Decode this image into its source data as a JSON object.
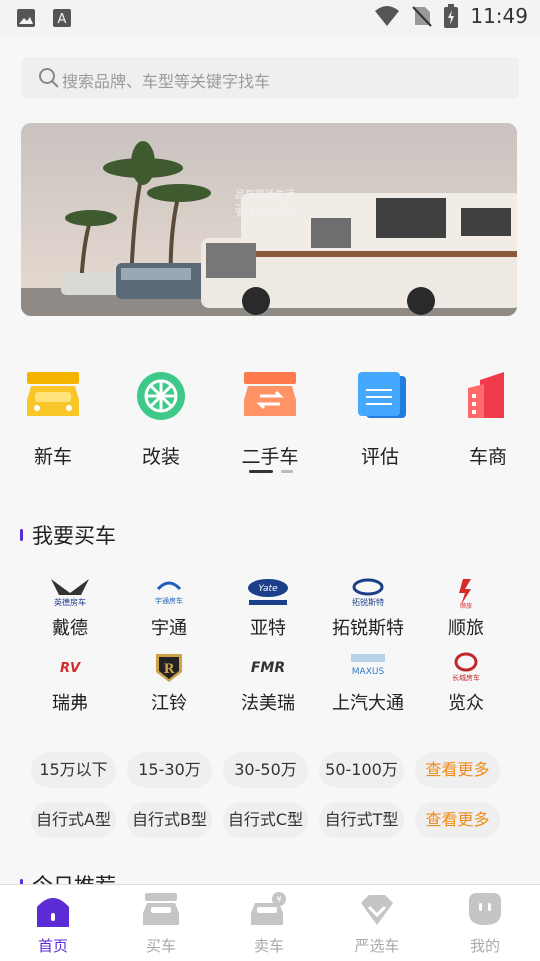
{
  "status_bar": {
    "time": "11:49"
  },
  "search": {
    "placeholder": "搜索品牌、车型等关键字找车"
  },
  "banner": {
    "caption_line1": "品享舒适生活",
    "caption_line2": "安逸出行体验"
  },
  "categories": [
    {
      "label": "新车",
      "icon": "new-car-icon",
      "color": "#f6b400"
    },
    {
      "label": "改装",
      "icon": "wheel-icon",
      "color": "#3cc98a"
    },
    {
      "label": "二手车",
      "icon": "used-car-icon",
      "color": "#ff7a4a"
    },
    {
      "label": "评估",
      "icon": "document-icon",
      "color": "#2a8ff0"
    },
    {
      "label": "车商",
      "icon": "building-icon",
      "color": "#ef3b4a"
    }
  ],
  "section_buy": {
    "title": "我要买车"
  },
  "brands": [
    {
      "name": "戴德",
      "logo_text": "英德房车"
    },
    {
      "name": "宇通",
      "logo_text": "宇通房车"
    },
    {
      "name": "亚特",
      "logo_text": "Yate"
    },
    {
      "name": "拓锐斯特",
      "logo_text": "拓锐斯特"
    },
    {
      "name": "顺旅",
      "logo_text": "顺旅"
    },
    {
      "name": "瑞弗",
      "logo_text": "RV"
    },
    {
      "name": "江铃",
      "logo_text": "R"
    },
    {
      "name": "法美瑞",
      "logo_text": "FMR"
    },
    {
      "name": "上汽大通",
      "logo_text": "MAXUS"
    },
    {
      "name": "览众",
      "logo_text": "长城房车"
    }
  ],
  "price_filters": [
    "15万以下",
    "15-30万",
    "30-50万",
    "50-100万"
  ],
  "type_filters": [
    "自行式A型",
    "自行式B型",
    "自行式C型",
    "自行式T型"
  ],
  "more_label": "查看更多",
  "section_today": {
    "title": "今日推荐"
  },
  "tabs": [
    {
      "label": "首页",
      "icon": "home-icon",
      "active": true
    },
    {
      "label": "买车",
      "icon": "car-icon",
      "active": false
    },
    {
      "label": "卖车",
      "icon": "sell-car-icon",
      "active": false
    },
    {
      "label": "严选车",
      "icon": "diamond-icon",
      "active": false
    },
    {
      "label": "我的",
      "icon": "profile-icon",
      "active": false
    }
  ],
  "colors": {
    "accent": "#5b2bd6",
    "more": "#f08b1a"
  }
}
